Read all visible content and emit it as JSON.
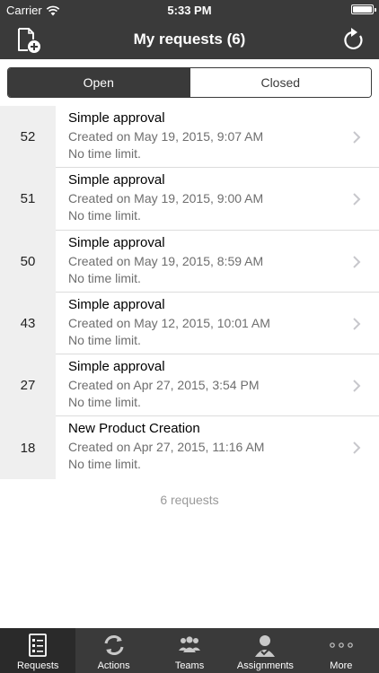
{
  "status_bar": {
    "carrier": "Carrier",
    "time": "5:33 PM"
  },
  "navbar": {
    "title": "My requests (6)",
    "left_icon": "new-document-icon",
    "right_icon": "refresh-icon"
  },
  "segments": {
    "open": "Open",
    "closed": "Closed",
    "selected": "Open"
  },
  "requests": [
    {
      "id": "52",
      "title": "Simple approval",
      "created": "Created on May 19, 2015, 9:07 AM",
      "limit": "No time limit."
    },
    {
      "id": "51",
      "title": "Simple approval",
      "created": "Created on May 19, 2015, 9:00 AM",
      "limit": "No time limit."
    },
    {
      "id": "50",
      "title": "Simple approval",
      "created": "Created on May 19, 2015, 8:59 AM",
      "limit": "No time limit."
    },
    {
      "id": "43",
      "title": "Simple approval",
      "created": "Created on May 12, 2015, 10:01 AM",
      "limit": "No time limit."
    },
    {
      "id": "27",
      "title": "Simple approval",
      "created": "Created on Apr 27, 2015, 3:54 PM",
      "limit": "No time limit."
    },
    {
      "id": "18",
      "title": "New Product Creation",
      "created": "Created on Apr 27, 2015, 11:16 AM",
      "limit": "No time limit."
    }
  ],
  "count_text": "6 requests",
  "tabbar": {
    "selected": "Requests",
    "tabs": [
      {
        "label": "Requests",
        "icon": "requests-list-icon"
      },
      {
        "label": "Actions",
        "icon": "actions-cycle-icon"
      },
      {
        "label": "Teams",
        "icon": "teams-icon"
      },
      {
        "label": "Assignments",
        "icon": "assignments-person-icon"
      },
      {
        "label": "More",
        "icon": "more-dots-icon"
      }
    ]
  },
  "colors": {
    "header": "#3a3a3a",
    "id_column": "#efefef",
    "secondary_text": "#6e6e6e",
    "count_text": "#9a9a9a"
  }
}
